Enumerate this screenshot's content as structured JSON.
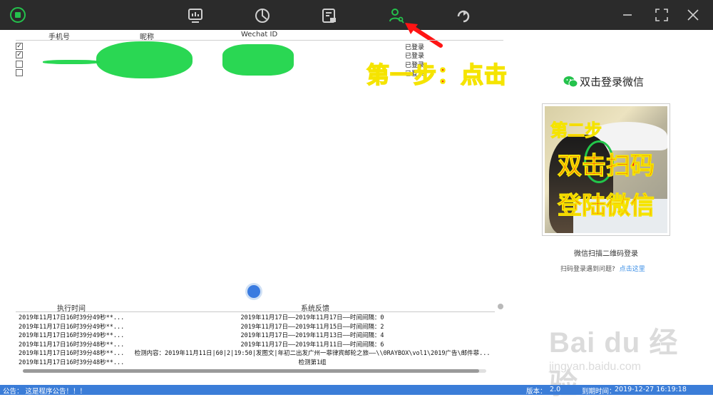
{
  "titlebar": {
    "nav_icons": [
      "monitor-icon",
      "chart-icon",
      "document-lock-icon",
      "user-key-icon",
      "refresh-icon"
    ],
    "active_icon": "user-key-icon",
    "accent_color": "#24c24c"
  },
  "accounts": {
    "columns": [
      "手机号",
      "昵称",
      "Wechat ID"
    ],
    "rows": [
      {
        "checked": true,
        "status": "已登录"
      },
      {
        "checked": true,
        "status": "已登录"
      },
      {
        "checked": false,
        "status": "已登录"
      },
      {
        "checked": false,
        "status": "已登录"
      }
    ],
    "check_mark": "✓"
  },
  "annotations": {
    "step1": "第一步：点击",
    "step2_line1": "第二步",
    "step2_line2": "双击扫码",
    "step2_line3": "登陆微信"
  },
  "login": {
    "title": "双击登录微信",
    "caption": "微信扫描二维码登录",
    "help_text": "扫码登录遇到问题?",
    "help_link": "点击这里"
  },
  "log": {
    "columns": [
      "执行时间",
      "系统反馈"
    ],
    "rows": [
      {
        "time": "2019年11月17日16时39分49秒**...",
        "feedback": "2019年11月17日——2019年11月17日——时间间隔：0"
      },
      {
        "time": "2019年11月17日16时39分49秒**...",
        "feedback": "2019年11月17日——2019年11月15日——时间间隔：2"
      },
      {
        "time": "2019年11月17日16时39分49秒**...",
        "feedback": "2019年11月17日——2019年11月13日——时间间隔：4"
      },
      {
        "time": "2019年11月17日16时39分48秒**...",
        "feedback": "2019年11月17日——2019年11月11日——时间间隔：6"
      },
      {
        "time": "2019年11月17日16时39分48秒**...",
        "feedback": "检测内容：2019年11月11日|60|2|19:50|发图文|年初二出发广州一菲律宾邮轮之旅——\\\\0RAYBOX\\vol1\\2019广告\\邮件菲..."
      },
      {
        "time": "2019年11月17日16时39分48秒**...",
        "feedback": "检测第1组"
      }
    ]
  },
  "statusbar": {
    "notice": "公告：  这是程序公告！！！",
    "version_label": "版本：",
    "version": "2.0",
    "expire_label": "到期时间：",
    "expire": "2019-12-27 16:19:18"
  },
  "watermark": {
    "brand": "Bai du 经验",
    "sub": "jingyan.baidu.com"
  }
}
